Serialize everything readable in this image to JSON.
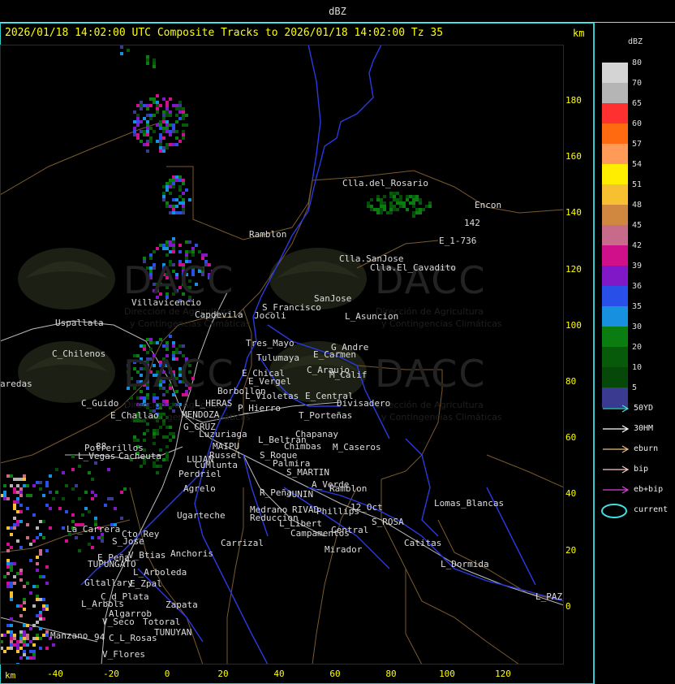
{
  "header": {
    "title": "dBZ"
  },
  "map_title": "2026/01/18 14:02:00 UTC Composite Tracks to 2026/01/18 14:02:00 Tz 35",
  "axis_unit": "km",
  "y_ticks": [
    "180",
    "160",
    "140",
    "120",
    "100",
    "80",
    "60",
    "40",
    "20",
    "0"
  ],
  "x_ticks": [
    "-40",
    "-20",
    "0",
    "20",
    "40",
    "60",
    "80",
    "100",
    "120"
  ],
  "legend": {
    "title": "dBZ",
    "scale": [
      {
        "label": "80",
        "color": "#d4d4d4"
      },
      {
        "label": "70",
        "color": "#b5b5b5"
      },
      {
        "label": "65",
        "color": "#ff3030"
      },
      {
        "label": "60",
        "color": "#ff6a10"
      },
      {
        "label": "57",
        "color": "#ff9a58"
      },
      {
        "label": "54",
        "color": "#ffee00"
      },
      {
        "label": "51",
        "color": "#f6c030"
      },
      {
        "label": "48",
        "color": "#d08840"
      },
      {
        "label": "45",
        "color": "#c86a8a"
      },
      {
        "label": "42",
        "color": "#d0108a"
      },
      {
        "label": "39",
        "color": "#8018c8"
      },
      {
        "label": "36",
        "color": "#2850e8"
      },
      {
        "label": "35",
        "color": "#1890e0"
      },
      {
        "label": "30",
        "color": "#0a7c10"
      },
      {
        "label": "20",
        "color": "#065a0a"
      },
      {
        "label": "10",
        "color": "#064808"
      },
      {
        "label": "5",
        "color": "#3a3a90"
      }
    ],
    "tracks": [
      {
        "label": "50YD",
        "color": "#40e0e0"
      },
      {
        "label": "30HM",
        "color": "#ffffff"
      },
      {
        "label": "eburn",
        "color": "#e8c080"
      },
      {
        "label": "bip",
        "color": "#ffc8c8"
      },
      {
        "label": "eb+bip",
        "color": "#e040e0"
      }
    ],
    "current_label": "current",
    "current_color": "#40e0e0"
  },
  "watermark": {
    "brand": "DACC",
    "line1": "Dirección de Agricultura",
    "line2": "y Contingencias Climáticas"
  },
  "places": [
    {
      "name": "Clla.del_Rosario",
      "x": 422,
      "y": 226
    },
    {
      "name": "Encon",
      "x": 585,
      "y": 253
    },
    {
      "name": "142",
      "x": 572,
      "y": 275
    },
    {
      "name": "E_1-736",
      "x": 541,
      "y": 297
    },
    {
      "name": "Ramblon",
      "x": 307,
      "y": 289
    },
    {
      "name": "Clla.SanJose",
      "x": 418,
      "y": 319
    },
    {
      "name": "Clla.El_Cavadito",
      "x": 456,
      "y": 330
    },
    {
      "name": "Villavicencio",
      "x": 162,
      "y": 373
    },
    {
      "name": "Capdevila",
      "x": 240,
      "y": 388
    },
    {
      "name": "S_Francisco",
      "x": 323,
      "y": 379
    },
    {
      "name": "Jocoli",
      "x": 313,
      "y": 389
    },
    {
      "name": "SanJose",
      "x": 387,
      "y": 368
    },
    {
      "name": "L_Asuncion",
      "x": 425,
      "y": 390
    },
    {
      "name": "Uspallata",
      "x": 68,
      "y": 398
    },
    {
      "name": "Tres_Mayo",
      "x": 303,
      "y": 423
    },
    {
      "name": "G_Andre",
      "x": 408,
      "y": 428
    },
    {
      "name": "C_Chilenos",
      "x": 64,
      "y": 436
    },
    {
      "name": "Tulumaya",
      "x": 316,
      "y": 441
    },
    {
      "name": "E_Carmen",
      "x": 386,
      "y": 437
    },
    {
      "name": "C_Araujo",
      "x": 378,
      "y": 456
    },
    {
      "name": "E_Chical",
      "x": 298,
      "y": 460
    },
    {
      "name": "M_Calif",
      "x": 406,
      "y": 462
    },
    {
      "name": "E_Vergel",
      "x": 306,
      "y": 470
    },
    {
      "name": "aredas",
      "x": 0,
      "y": 473
    },
    {
      "name": "Borbollon",
      "x": 268,
      "y": 482
    },
    {
      "name": "E_Central",
      "x": 376,
      "y": 488
    },
    {
      "name": "L_Violetas",
      "x": 302,
      "y": 488
    },
    {
      "name": "C_Guido",
      "x": 100,
      "y": 497
    },
    {
      "name": "L_HERAS",
      "x": 240,
      "y": 497
    },
    {
      "name": "Divisadero",
      "x": 415,
      "y": 497
    },
    {
      "name": "P_Hierro",
      "x": 293,
      "y": 503
    },
    {
      "name": "E_Challao",
      "x": 136,
      "y": 512
    },
    {
      "name": "MENDOZA",
      "x": 224,
      "y": 511
    },
    {
      "name": "T_Porteñas",
      "x": 368,
      "y": 512
    },
    {
      "name": "G_CRUZ",
      "x": 226,
      "y": 526
    },
    {
      "name": "Luzuriaga",
      "x": 245,
      "y": 535
    },
    {
      "name": "Chapanay",
      "x": 364,
      "y": 535
    },
    {
      "name": "L_Beltran",
      "x": 318,
      "y": 542
    },
    {
      "name": "88",
      "x": 118,
      "y": 550
    },
    {
      "name": "Potrerillos",
      "x": 104,
      "y": 552
    },
    {
      "name": "MAIPU",
      "x": 262,
      "y": 550
    },
    {
      "name": "Chimbas",
      "x": 350,
      "y": 550
    },
    {
      "name": "M_Caseros",
      "x": 410,
      "y": 551
    },
    {
      "name": "Russel",
      "x": 258,
      "y": 561
    },
    {
      "name": "L_Vegas",
      "x": 96,
      "y": 562
    },
    {
      "name": "Cacheuta",
      "x": 146,
      "y": 562
    },
    {
      "name": "S_Roque",
      "x": 320,
      "y": 561
    },
    {
      "name": "LUJAN",
      "x": 230,
      "y": 566
    },
    {
      "name": "Palmira",
      "x": 336,
      "y": 571
    },
    {
      "name": "CuMlunta",
      "x": 240,
      "y": 573
    },
    {
      "name": "Perdriel",
      "x": 220,
      "y": 584
    },
    {
      "name": "S_MARTIN",
      "x": 353,
      "y": 582
    },
    {
      "name": "A_Verde",
      "x": 384,
      "y": 597
    },
    {
      "name": "Agrelo",
      "x": 226,
      "y": 602
    },
    {
      "name": "Ramblon",
      "x": 406,
      "y": 602
    },
    {
      "name": "R_Peña",
      "x": 320,
      "y": 607
    },
    {
      "name": "JUNIN",
      "x": 353,
      "y": 609
    },
    {
      "name": "Lomas_Blancas",
      "x": 535,
      "y": 620
    },
    {
      "name": "12_Oct",
      "x": 432,
      "y": 625
    },
    {
      "name": "Medrano",
      "x": 308,
      "y": 628
    },
    {
      "name": "RIVAD",
      "x": 360,
      "y": 628
    },
    {
      "name": "Phillips",
      "x": 390,
      "y": 630
    },
    {
      "name": "Ugarteche",
      "x": 218,
      "y": 635
    },
    {
      "name": "Reduccion",
      "x": 308,
      "y": 638
    },
    {
      "name": "S_ROSA",
      "x": 458,
      "y": 643
    },
    {
      "name": "L_Libert",
      "x": 344,
      "y": 645
    },
    {
      "name": "La_Carrera",
      "x": 82,
      "y": 652
    },
    {
      "name": "Central",
      "x": 408,
      "y": 653
    },
    {
      "name": "Cto_Rey",
      "x": 150,
      "y": 658
    },
    {
      "name": "Campamentos",
      "x": 358,
      "y": 657
    },
    {
      "name": "S_Jose",
      "x": 138,
      "y": 667
    },
    {
      "name": "Carrizal",
      "x": 272,
      "y": 669
    },
    {
      "name": "Catitas",
      "x": 498,
      "y": 669
    },
    {
      "name": "Mirador",
      "x": 400,
      "y": 677
    },
    {
      "name": "Anchoris",
      "x": 210,
      "y": 682
    },
    {
      "name": "V_Btias",
      "x": 158,
      "y": 684
    },
    {
      "name": "E_Peña",
      "x": 120,
      "y": 687
    },
    {
      "name": "TUPUNGATO",
      "x": 108,
      "y": 695
    },
    {
      "name": "L_Dormida",
      "x": 543,
      "y": 695
    },
    {
      "name": "L_Arboleda",
      "x": 164,
      "y": 705
    },
    {
      "name": "Gltallary",
      "x": 104,
      "y": 718
    },
    {
      "name": "E_Zpal",
      "x": 160,
      "y": 719
    },
    {
      "name": "C_d_Plata",
      "x": 124,
      "y": 735
    },
    {
      "name": "L_PAZ",
      "x": 660,
      "y": 735
    },
    {
      "name": "L_Arbols",
      "x": 100,
      "y": 744
    },
    {
      "name": "Zapata",
      "x": 204,
      "y": 745
    },
    {
      "name": "Algarrob",
      "x": 134,
      "y": 756
    },
    {
      "name": "V_Seco",
      "x": 126,
      "y": 766
    },
    {
      "name": "Totoral",
      "x": 176,
      "y": 766
    },
    {
      "name": "TUNUYAN",
      "x": 190,
      "y": 779
    },
    {
      "name": "Manzano",
      "x": 62,
      "y": 783
    },
    {
      "name": "94",
      "x": 116,
      "y": 785
    },
    {
      "name": "C_L_Rosas",
      "x": 134,
      "y": 786
    },
    {
      "name": "V_Flores",
      "x": 126,
      "y": 806
    }
  ]
}
